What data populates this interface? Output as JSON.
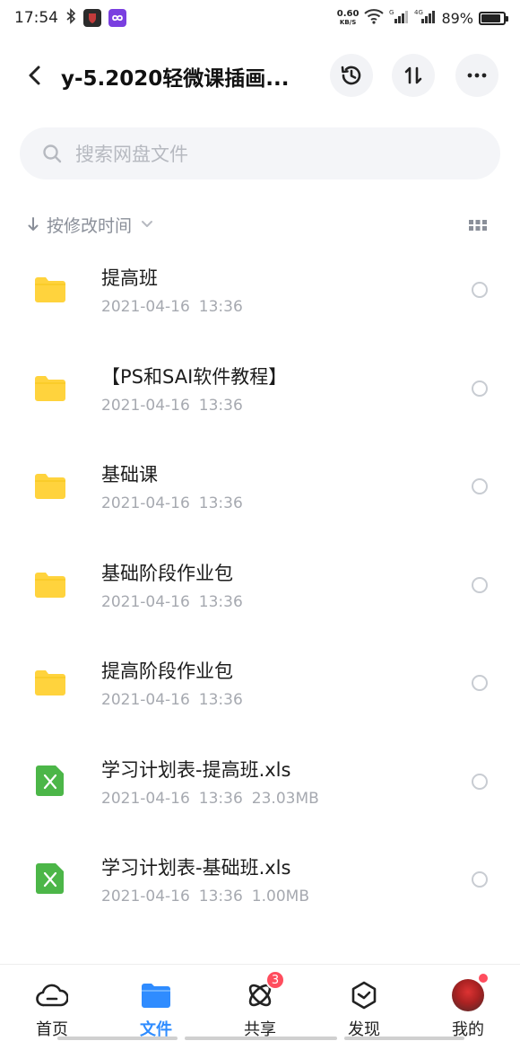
{
  "status_bar": {
    "time": "17:54",
    "net_speed_value": "0.60",
    "net_speed_unit": "KB/S",
    "battery": "89%",
    "battery_level": 0.89
  },
  "header": {
    "title": "y-5.2020轻微课插画..."
  },
  "search": {
    "placeholder": "搜索网盘文件"
  },
  "sort": {
    "label": "按修改时间"
  },
  "files": [
    {
      "name": "提高班",
      "date": "2021-04-16",
      "time": "13:36",
      "size": "",
      "type": "folder"
    },
    {
      "name": "【PS和SAI软件教程】",
      "date": "2021-04-16",
      "time": "13:36",
      "size": "",
      "type": "folder"
    },
    {
      "name": "基础课",
      "date": "2021-04-16",
      "time": "13:36",
      "size": "",
      "type": "folder"
    },
    {
      "name": "基础阶段作业包",
      "date": "2021-04-16",
      "time": "13:36",
      "size": "",
      "type": "folder"
    },
    {
      "name": "提高阶段作业包",
      "date": "2021-04-16",
      "time": "13:36",
      "size": "",
      "type": "folder"
    },
    {
      "name": "学习计划表-提高班.xls",
      "date": "2021-04-16",
      "time": "13:36",
      "size": "23.03MB",
      "type": "xls"
    },
    {
      "name": "学习计划表-基础班.xls",
      "date": "2021-04-16",
      "time": "13:36",
      "size": "1.00MB",
      "type": "xls"
    }
  ],
  "tabs": [
    {
      "label": "首页",
      "icon": "cloud-icon",
      "active": false
    },
    {
      "label": "文件",
      "icon": "folder-icon",
      "active": true
    },
    {
      "label": "共享",
      "icon": "share-atom-icon",
      "active": false,
      "badge": "3"
    },
    {
      "label": "发现",
      "icon": "discover-cube-icon",
      "active": false
    },
    {
      "label": "我的",
      "icon": "avatar",
      "active": false
    }
  ],
  "colors": {
    "accent": "#2f8cff",
    "folder": "#ffd33d",
    "xls": "#4cb648",
    "badge": "#ff4d5e"
  }
}
